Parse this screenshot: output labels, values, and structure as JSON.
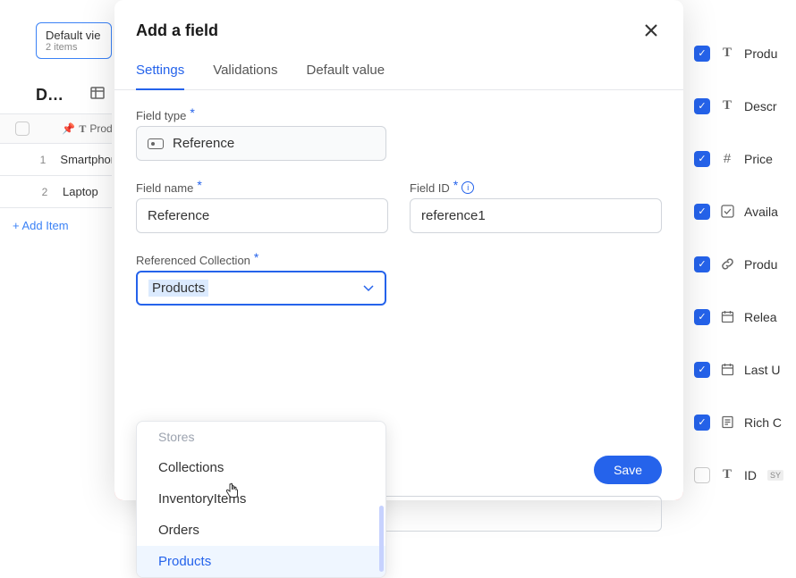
{
  "background": {
    "view_chip_title": "Default vie",
    "view_chip_sub": "2 items",
    "header_d": "D…",
    "col_header": "Prod",
    "rows": [
      {
        "num": "1",
        "name": "Smartphor"
      },
      {
        "num": "2",
        "name": "Laptop"
      }
    ],
    "add_item_label": "Add Item"
  },
  "right_fields": [
    {
      "icon": "T",
      "label": "Produ"
    },
    {
      "icon": "T",
      "label": "Descr"
    },
    {
      "icon": "#",
      "label": "Price"
    },
    {
      "icon": "☑",
      "label": "Availa"
    },
    {
      "icon": "🔗",
      "label": "Produ"
    },
    {
      "icon": "📅",
      "label": "Relea"
    },
    {
      "icon": "📅",
      "label": "Last U"
    },
    {
      "icon": "📄",
      "label": "Rich C"
    },
    {
      "icon": "T",
      "label": "ID",
      "badge": "SY"
    }
  ],
  "modal": {
    "title": "Add a field",
    "tabs": {
      "settings": "Settings",
      "validations": "Validations",
      "default_value": "Default value"
    },
    "labels": {
      "field_type": "Field type",
      "field_name": "Field name",
      "field_id": "Field ID",
      "referenced_collection": "Referenced Collection"
    },
    "values": {
      "field_type": "Reference",
      "field_name": "Reference",
      "field_id": "reference1",
      "referenced_collection": "Products"
    },
    "dropdown": {
      "group": "Stores",
      "items": [
        "Collections",
        "InventoryItems",
        "Orders",
        "Products"
      ]
    },
    "save_label": "Save"
  }
}
